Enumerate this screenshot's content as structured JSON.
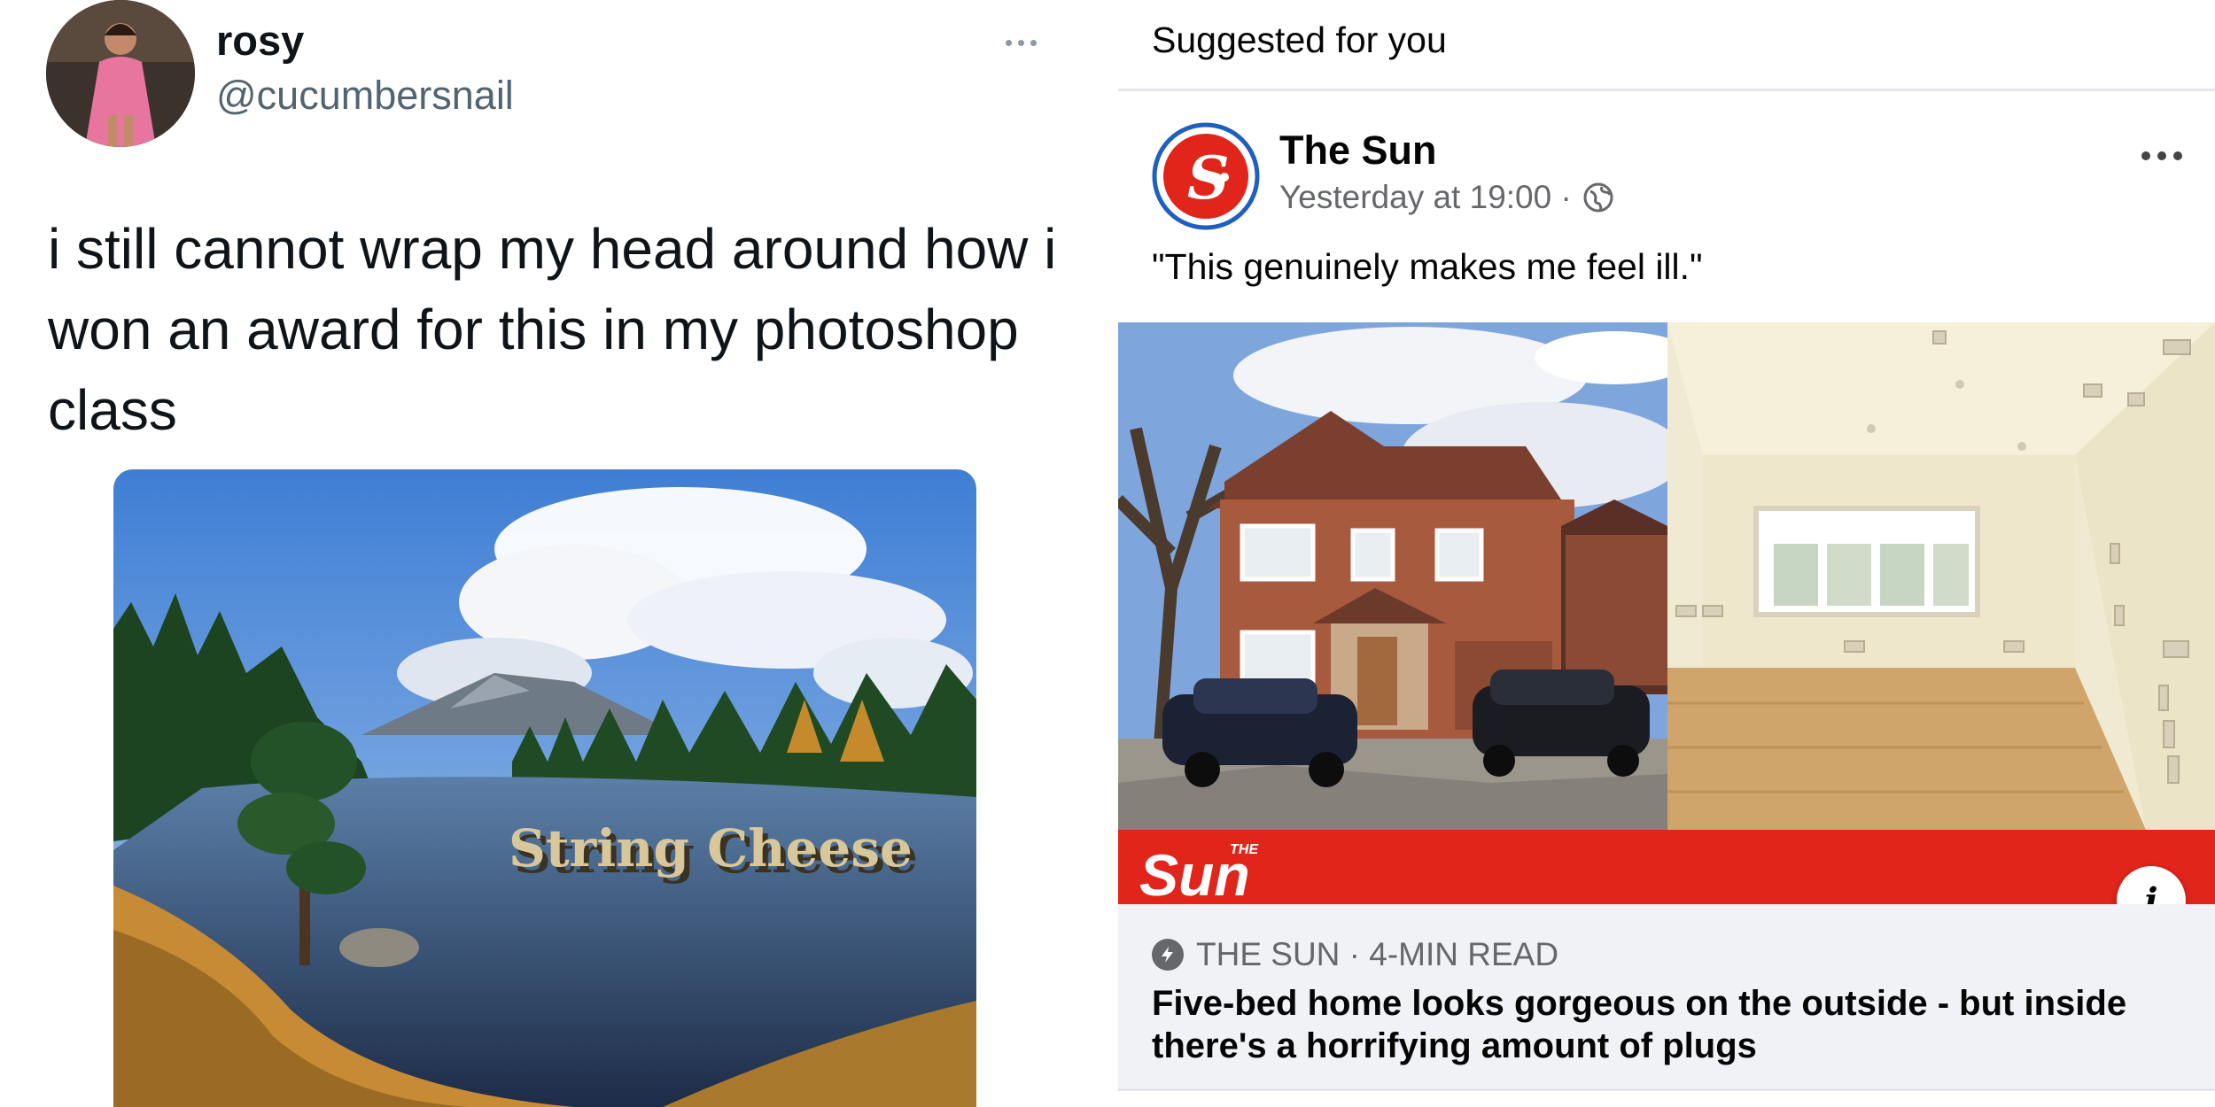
{
  "tweet": {
    "author_name": "rosy",
    "author_handle": "@cucumbersnail",
    "text": "i still cannot wrap my head around how i won an award for this in my photoshop class",
    "photo_caption_text": "String Cheese",
    "more_icon": "ellipsis-icon"
  },
  "facebook": {
    "section_label": "Suggested for you",
    "page_name": "The Sun",
    "post_time": "Yesterday at 19:00 ·",
    "audience_icon": "globe-icon",
    "more_icon": "ellipsis-icon",
    "post_text": "\"This genuinely makes me feel ill.\"",
    "brand_logo_text": "Sun",
    "brand_logo_small": "THE",
    "info_label": "i",
    "link_source": "THE SUN · 4-MIN READ",
    "link_title": "Five-bed home looks gorgeous on the outside - but inside there's a horrifying amount of plugs",
    "colors": {
      "sun_red": "#e1251b",
      "link_bg": "#f0f2f5",
      "meta_gray": "#65676b"
    }
  }
}
